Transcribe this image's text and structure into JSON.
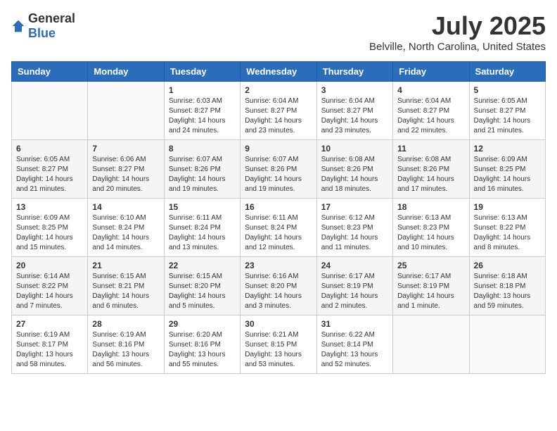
{
  "logo": {
    "general": "General",
    "blue": "Blue"
  },
  "header": {
    "month_year": "July 2025",
    "location": "Belville, North Carolina, United States"
  },
  "weekdays": [
    "Sunday",
    "Monday",
    "Tuesday",
    "Wednesday",
    "Thursday",
    "Friday",
    "Saturday"
  ],
  "weeks": [
    [
      {
        "day": "",
        "details": ""
      },
      {
        "day": "",
        "details": ""
      },
      {
        "day": "1",
        "details": "Sunrise: 6:03 AM\nSunset: 8:27 PM\nDaylight: 14 hours and 24 minutes."
      },
      {
        "day": "2",
        "details": "Sunrise: 6:04 AM\nSunset: 8:27 PM\nDaylight: 14 hours and 23 minutes."
      },
      {
        "day": "3",
        "details": "Sunrise: 6:04 AM\nSunset: 8:27 PM\nDaylight: 14 hours and 23 minutes."
      },
      {
        "day": "4",
        "details": "Sunrise: 6:04 AM\nSunset: 8:27 PM\nDaylight: 14 hours and 22 minutes."
      },
      {
        "day": "5",
        "details": "Sunrise: 6:05 AM\nSunset: 8:27 PM\nDaylight: 14 hours and 21 minutes."
      }
    ],
    [
      {
        "day": "6",
        "details": "Sunrise: 6:05 AM\nSunset: 8:27 PM\nDaylight: 14 hours and 21 minutes."
      },
      {
        "day": "7",
        "details": "Sunrise: 6:06 AM\nSunset: 8:27 PM\nDaylight: 14 hours and 20 minutes."
      },
      {
        "day": "8",
        "details": "Sunrise: 6:07 AM\nSunset: 8:26 PM\nDaylight: 14 hours and 19 minutes."
      },
      {
        "day": "9",
        "details": "Sunrise: 6:07 AM\nSunset: 8:26 PM\nDaylight: 14 hours and 19 minutes."
      },
      {
        "day": "10",
        "details": "Sunrise: 6:08 AM\nSunset: 8:26 PM\nDaylight: 14 hours and 18 minutes."
      },
      {
        "day": "11",
        "details": "Sunrise: 6:08 AM\nSunset: 8:26 PM\nDaylight: 14 hours and 17 minutes."
      },
      {
        "day": "12",
        "details": "Sunrise: 6:09 AM\nSunset: 8:25 PM\nDaylight: 14 hours and 16 minutes."
      }
    ],
    [
      {
        "day": "13",
        "details": "Sunrise: 6:09 AM\nSunset: 8:25 PM\nDaylight: 14 hours and 15 minutes."
      },
      {
        "day": "14",
        "details": "Sunrise: 6:10 AM\nSunset: 8:24 PM\nDaylight: 14 hours and 14 minutes."
      },
      {
        "day": "15",
        "details": "Sunrise: 6:11 AM\nSunset: 8:24 PM\nDaylight: 14 hours and 13 minutes."
      },
      {
        "day": "16",
        "details": "Sunrise: 6:11 AM\nSunset: 8:24 PM\nDaylight: 14 hours and 12 minutes."
      },
      {
        "day": "17",
        "details": "Sunrise: 6:12 AM\nSunset: 8:23 PM\nDaylight: 14 hours and 11 minutes."
      },
      {
        "day": "18",
        "details": "Sunrise: 6:13 AM\nSunset: 8:23 PM\nDaylight: 14 hours and 10 minutes."
      },
      {
        "day": "19",
        "details": "Sunrise: 6:13 AM\nSunset: 8:22 PM\nDaylight: 14 hours and 8 minutes."
      }
    ],
    [
      {
        "day": "20",
        "details": "Sunrise: 6:14 AM\nSunset: 8:22 PM\nDaylight: 14 hours and 7 minutes."
      },
      {
        "day": "21",
        "details": "Sunrise: 6:15 AM\nSunset: 8:21 PM\nDaylight: 14 hours and 6 minutes."
      },
      {
        "day": "22",
        "details": "Sunrise: 6:15 AM\nSunset: 8:20 PM\nDaylight: 14 hours and 5 minutes."
      },
      {
        "day": "23",
        "details": "Sunrise: 6:16 AM\nSunset: 8:20 PM\nDaylight: 14 hours and 3 minutes."
      },
      {
        "day": "24",
        "details": "Sunrise: 6:17 AM\nSunset: 8:19 PM\nDaylight: 14 hours and 2 minutes."
      },
      {
        "day": "25",
        "details": "Sunrise: 6:17 AM\nSunset: 8:19 PM\nDaylight: 14 hours and 1 minute."
      },
      {
        "day": "26",
        "details": "Sunrise: 6:18 AM\nSunset: 8:18 PM\nDaylight: 13 hours and 59 minutes."
      }
    ],
    [
      {
        "day": "27",
        "details": "Sunrise: 6:19 AM\nSunset: 8:17 PM\nDaylight: 13 hours and 58 minutes."
      },
      {
        "day": "28",
        "details": "Sunrise: 6:19 AM\nSunset: 8:16 PM\nDaylight: 13 hours and 56 minutes."
      },
      {
        "day": "29",
        "details": "Sunrise: 6:20 AM\nSunset: 8:16 PM\nDaylight: 13 hours and 55 minutes."
      },
      {
        "day": "30",
        "details": "Sunrise: 6:21 AM\nSunset: 8:15 PM\nDaylight: 13 hours and 53 minutes."
      },
      {
        "day": "31",
        "details": "Sunrise: 6:22 AM\nSunset: 8:14 PM\nDaylight: 13 hours and 52 minutes."
      },
      {
        "day": "",
        "details": ""
      },
      {
        "day": "",
        "details": ""
      }
    ]
  ]
}
